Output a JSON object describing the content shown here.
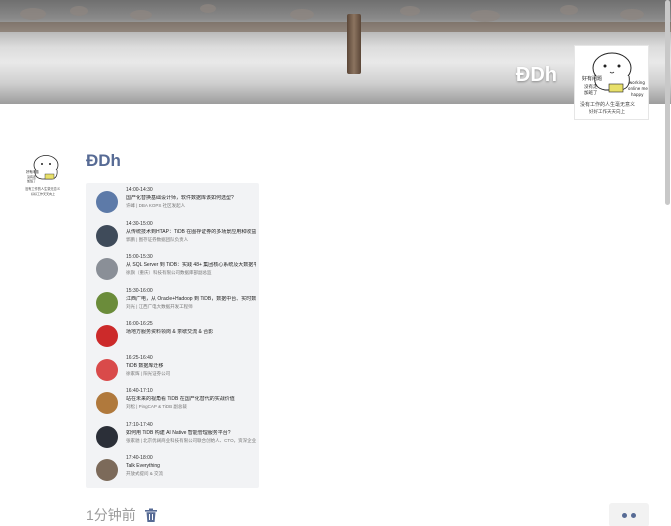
{
  "cover": {
    "user_name": "ĐDh",
    "avatar_text": [
      "好有问题",
      "没有走",
      "加班了",
      "working",
      "online me",
      "happy",
      "没有工作的人生毫无意义",
      "好好工作天天向上"
    ]
  },
  "post": {
    "author": "ĐDh",
    "avatar_text": [
      "好有问题",
      "没有走",
      "加班了",
      "没有工作的人生毫无意义",
      "好好工作天天向上"
    ],
    "time_ago": "1分钟前",
    "agenda": [
      {
        "time": "14:00-14:30",
        "title": "国产化替换基础设计师，软件数据库该如何选型?",
        "who": "许峰 | DBA KOPS 社区发起人",
        "color": "#5d7aa8"
      },
      {
        "time": "14:30-15:00",
        "title": "从传统技术到HTAP：TiDB 在图存证券的多场景应用和收益",
        "who": "郭鹏 | 图存证券数据团队负责人",
        "color": "#3f4b5a"
      },
      {
        "time": "15:00-15:30",
        "title": "从 SQL Server 到 TiDB：实践 48+ 集团核心系统及大数据平台的全面升级",
        "who": "徐旗（重庆）科技有限公司数据库部副总监",
        "color": "#8a8f97"
      },
      {
        "time": "15:30-16:00",
        "title": "江西广电，从 Oracle+Hadoop 到 TiDB，数据中台、实时数仓进阶分布",
        "who": "刘光 | 江西广电大数据开发工程师",
        "color": "#6b8c3a"
      },
      {
        "time": "16:00-16:25",
        "title": "场地方服务资料领岗 & 茶歇交流 & 合影",
        "who": "",
        "color": "#cc2a2a"
      },
      {
        "time": "16:25-16:40",
        "title": "TiDB 数据库迁移",
        "who": "徐家辉 | 阳光证券公司",
        "color": "#d94a4a"
      },
      {
        "time": "16:40-17:10",
        "title": "站在未来的视角看 TiDB 在国产化替代的实战价值",
        "who": "刘松 | PingCAP & TiDB 副总裁",
        "color": "#b0793c"
      },
      {
        "time": "17:10-17:40",
        "title": "如何用 TiDB 构建 AI Native 智能管理服务平台?",
        "who": "张家驰 | 北京优阔商业科技有限公司联合创始人、CTO，资深企业数字化咨询专家",
        "color": "#2b2f38"
      },
      {
        "time": "17:40-18:00",
        "title": "Talk Everything",
        "who": "开放式提问 & 交流",
        "color": "#7c6a5a"
      }
    ]
  },
  "icons": {
    "trash": "trash-icon",
    "more": "more-dots-icon"
  },
  "colors": {
    "name_link": "#576b95",
    "muted": "#9b9b9b"
  }
}
